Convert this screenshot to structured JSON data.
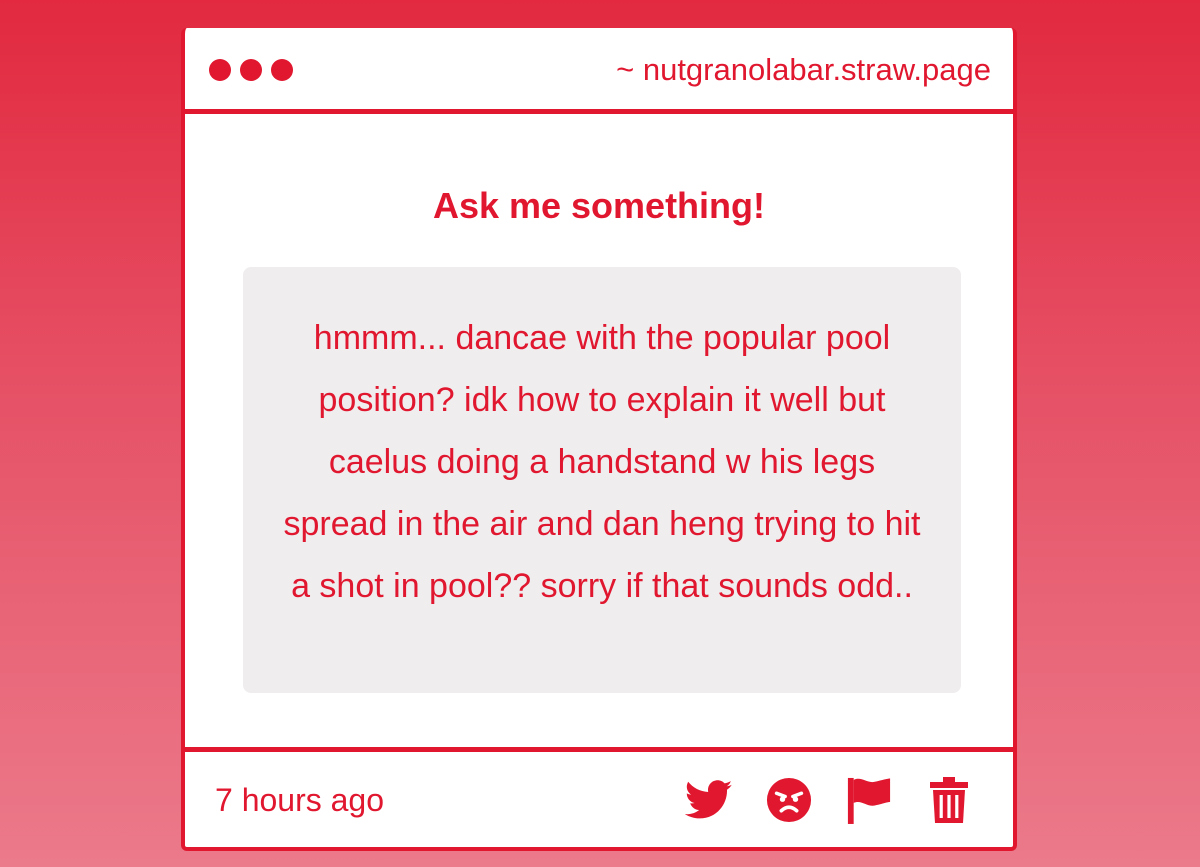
{
  "window": {
    "url": "~ nutgranolabar.straw.page"
  },
  "page": {
    "title": "Ask me something!"
  },
  "message": {
    "text": "hmmm... dancae with the popular pool position? idk how to explain it well but caelus doing a handstand w his legs spread in the air and dan heng trying to hit a shot in pool?? sorry if that sounds odd.."
  },
  "footer": {
    "timestamp": "7 hours ago",
    "actions": [
      {
        "icon": "twitter-icon"
      },
      {
        "icon": "angry-face-icon"
      },
      {
        "icon": "flag-icon"
      },
      {
        "icon": "trash-icon"
      }
    ]
  },
  "colors": {
    "accent": "#e0172f",
    "background_top": "#e2293f",
    "background_bottom": "#eb7a8a",
    "message_bg": "#efedee",
    "card_bg": "#ffffff"
  }
}
